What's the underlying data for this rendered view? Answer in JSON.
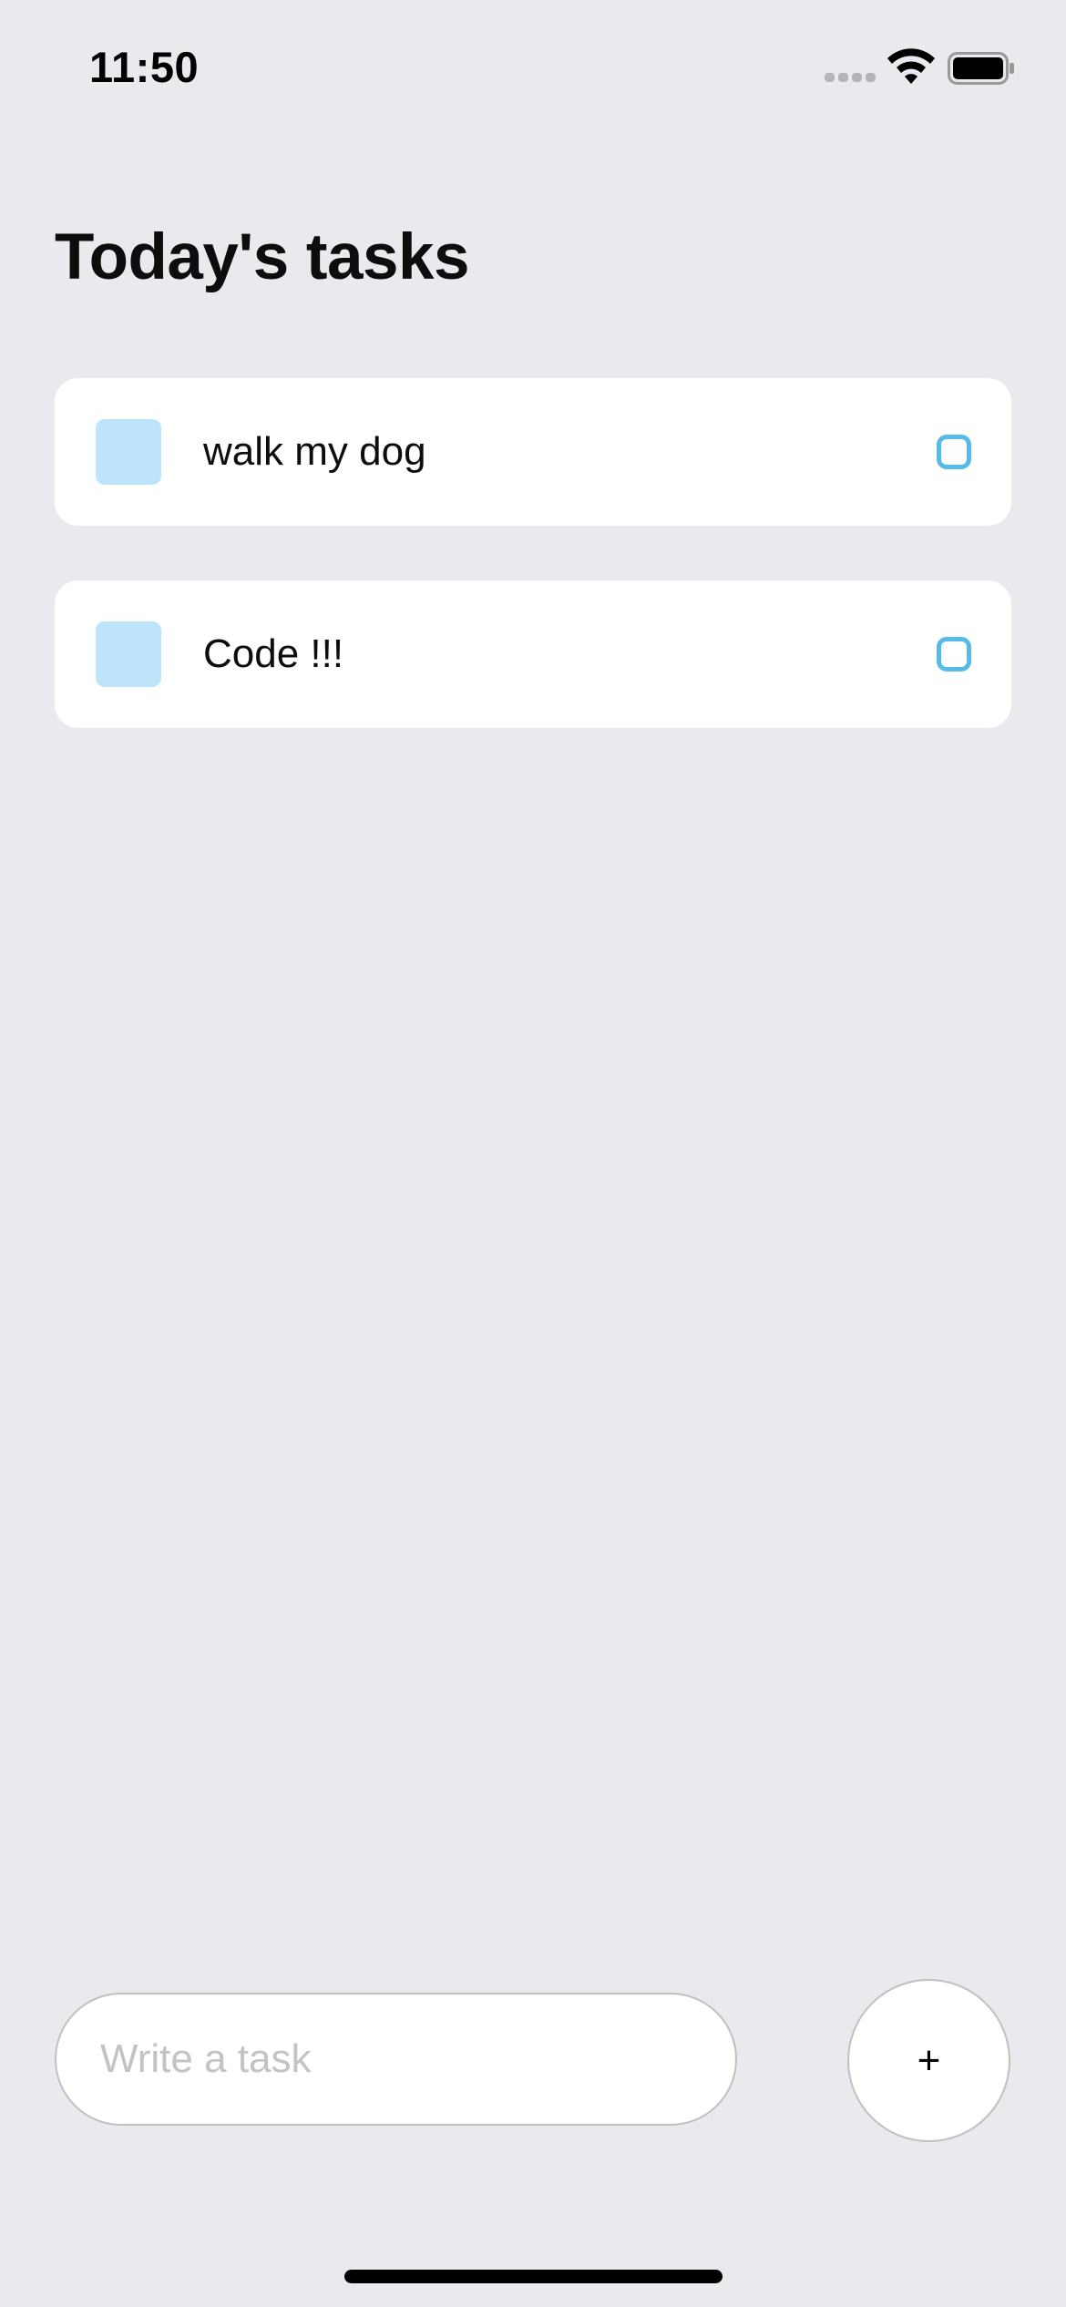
{
  "status_bar": {
    "time": "11:50",
    "icons": [
      "cellular-signal-icon",
      "wifi-icon",
      "battery-icon"
    ]
  },
  "title": "Today's tasks",
  "tasks": [
    {
      "label": "walk my dog"
    },
    {
      "label": "Code !!!"
    }
  ],
  "input": {
    "placeholder": "Write a task",
    "value": ""
  },
  "add_button": {
    "label": "+"
  },
  "colors": {
    "background": "#e8eaed",
    "card": "#ffffff",
    "task_square": "#bde4f8",
    "task_circle_border": "#55bcea",
    "placeholder": "#c3c3c3"
  }
}
